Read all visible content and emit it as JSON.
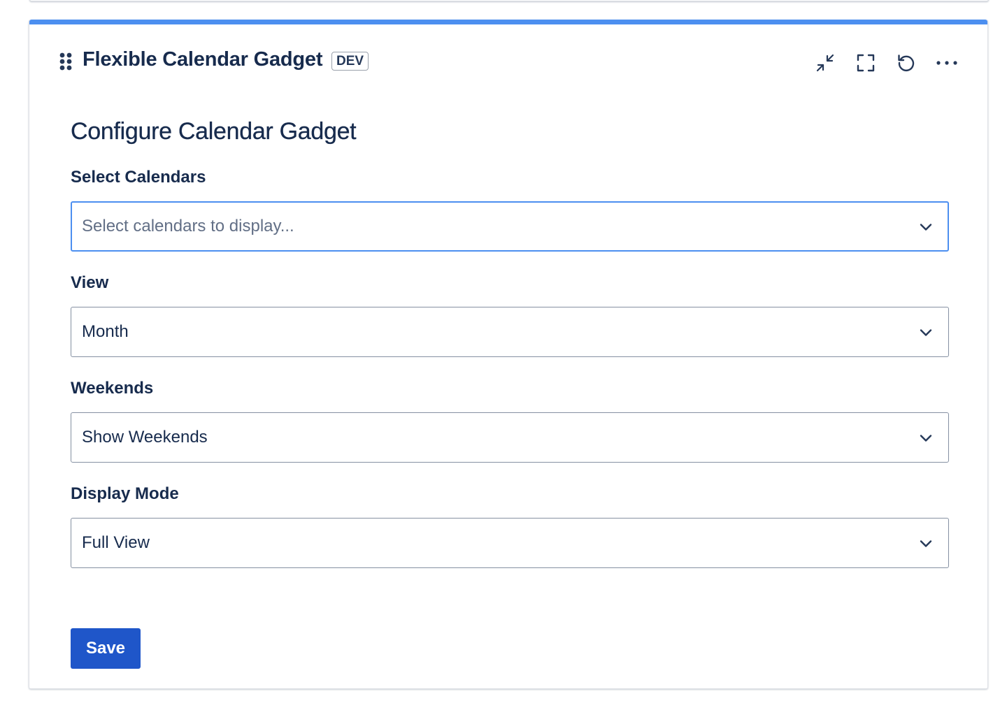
{
  "gadget": {
    "title": "Flexible Calendar Gadget",
    "badge": "DEV",
    "accent_color": "#4c8ff0",
    "actions": [
      {
        "name": "minimize",
        "icon": "minimize-icon"
      },
      {
        "name": "fullscreen",
        "icon": "fullscreen-icon"
      },
      {
        "name": "refresh",
        "icon": "refresh-icon"
      },
      {
        "name": "more",
        "icon": "more-horizontal-icon"
      }
    ]
  },
  "form": {
    "heading": "Configure Calendar Gadget",
    "fields": {
      "calendars": {
        "label": "Select Calendars",
        "value": "",
        "placeholder": "Select calendars to display..."
      },
      "view": {
        "label": "View",
        "value": "Month"
      },
      "weekends": {
        "label": "Weekends",
        "value": "Show Weekends"
      },
      "display_mode": {
        "label": "Display Mode",
        "value": "Full View"
      }
    },
    "save_label": "Save",
    "save_color": "#1f56c9"
  }
}
